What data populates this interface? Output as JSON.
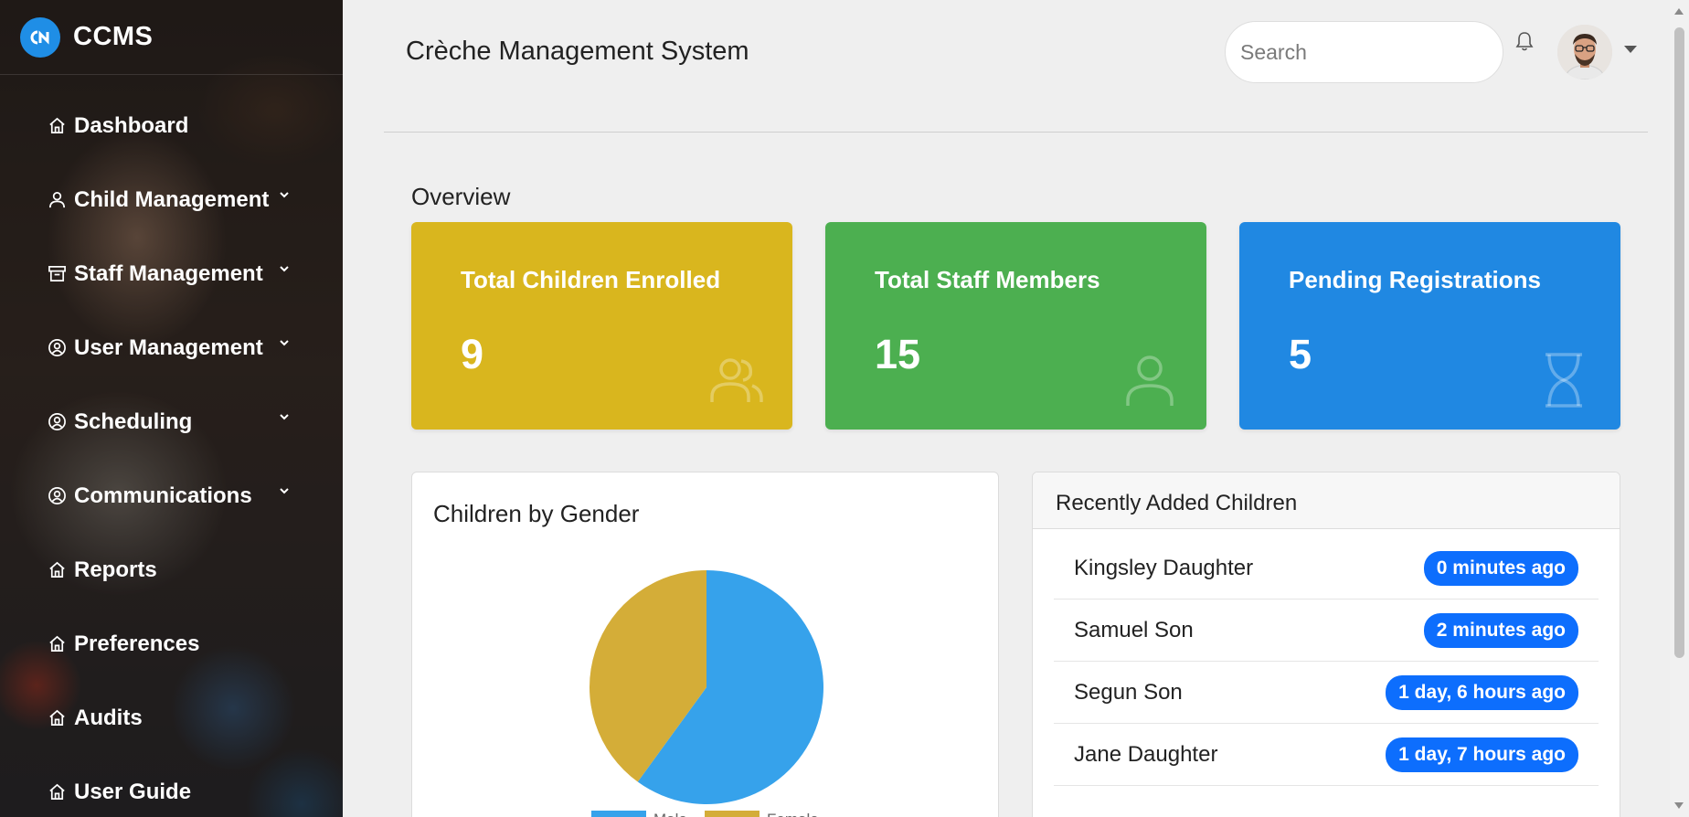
{
  "app": {
    "brand": "CCMS",
    "title": "Crèche Management System"
  },
  "sidebar": {
    "items": [
      {
        "label": "Dashboard",
        "icon": "home-icon",
        "has_dropdown": false
      },
      {
        "label": "Child Management",
        "icon": "person-icon",
        "has_dropdown": true
      },
      {
        "label": "Staff Management",
        "icon": "archive-icon",
        "has_dropdown": true
      },
      {
        "label": "User Management",
        "icon": "user-circle-icon",
        "has_dropdown": true
      },
      {
        "label": "Scheduling",
        "icon": "user-circle-icon",
        "has_dropdown": true
      },
      {
        "label": "Communications",
        "icon": "user-circle-icon",
        "has_dropdown": true
      },
      {
        "label": "Reports",
        "icon": "home-icon",
        "has_dropdown": false
      },
      {
        "label": "Preferences",
        "icon": "home-icon",
        "has_dropdown": false
      },
      {
        "label": "Audits",
        "icon": "home-icon",
        "has_dropdown": false
      },
      {
        "label": "User Guide",
        "icon": "home-icon",
        "has_dropdown": false
      }
    ]
  },
  "header": {
    "search_placeholder": "Search"
  },
  "overview": {
    "title": "Overview",
    "cards": [
      {
        "label": "Total Children Enrolled",
        "value": "9",
        "color": "#d9b61e",
        "icon": "people-icon"
      },
      {
        "label": "Total Staff Members",
        "value": "15",
        "color": "#4caf50",
        "icon": "person-icon"
      },
      {
        "label": "Pending Registrations",
        "value": "5",
        "color": "#2088e2",
        "icon": "hourglass-icon"
      }
    ]
  },
  "chart_card": {
    "title": "Children by Gender"
  },
  "chart_data": {
    "type": "pie",
    "title": "Children by Gender",
    "slices": [
      {
        "name": "Male",
        "value": 60,
        "color": "#36a2eb"
      },
      {
        "name": "Female",
        "value": 40,
        "color": "#d4ad38"
      }
    ],
    "legend": "bottom"
  },
  "recent": {
    "title": "Recently Added Children",
    "rows": [
      {
        "name": "Kingsley Daughter",
        "time": "0 minutes ago"
      },
      {
        "name": "Samuel Son",
        "time": "2 minutes ago"
      },
      {
        "name": "Segun Son",
        "time": "1 day, 6 hours ago"
      },
      {
        "name": "Jane Daughter",
        "time": "1 day, 7 hours ago"
      }
    ]
  }
}
